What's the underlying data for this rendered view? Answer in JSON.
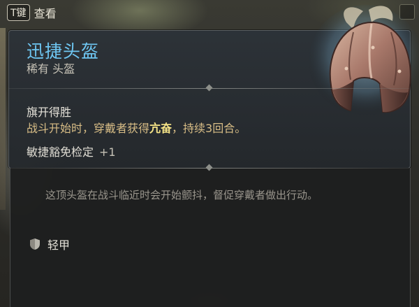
{
  "hint": {
    "key": "T键",
    "label": "查看"
  },
  "item": {
    "name": "迅捷头盔",
    "subtitle": "稀有 头盔",
    "feature": {
      "name": "旗开得胜",
      "desc_before": "战斗开始时，穿戴者获得",
      "keyword": "亢奋",
      "desc_after": "，持续3回合。"
    },
    "bonus": {
      "label": "敏捷豁免检定",
      "value": "+1"
    },
    "flavor": "这顶头盔在战斗临近时会开始颤抖，督促穿戴者做出行动。",
    "armor_type": "轻甲",
    "armor_icon": "shield-icon"
  },
  "colors": {
    "title": "#6ec6f2",
    "description": "#d8bd86",
    "keyword": "#f6e487",
    "flavor": "#9a968d"
  }
}
